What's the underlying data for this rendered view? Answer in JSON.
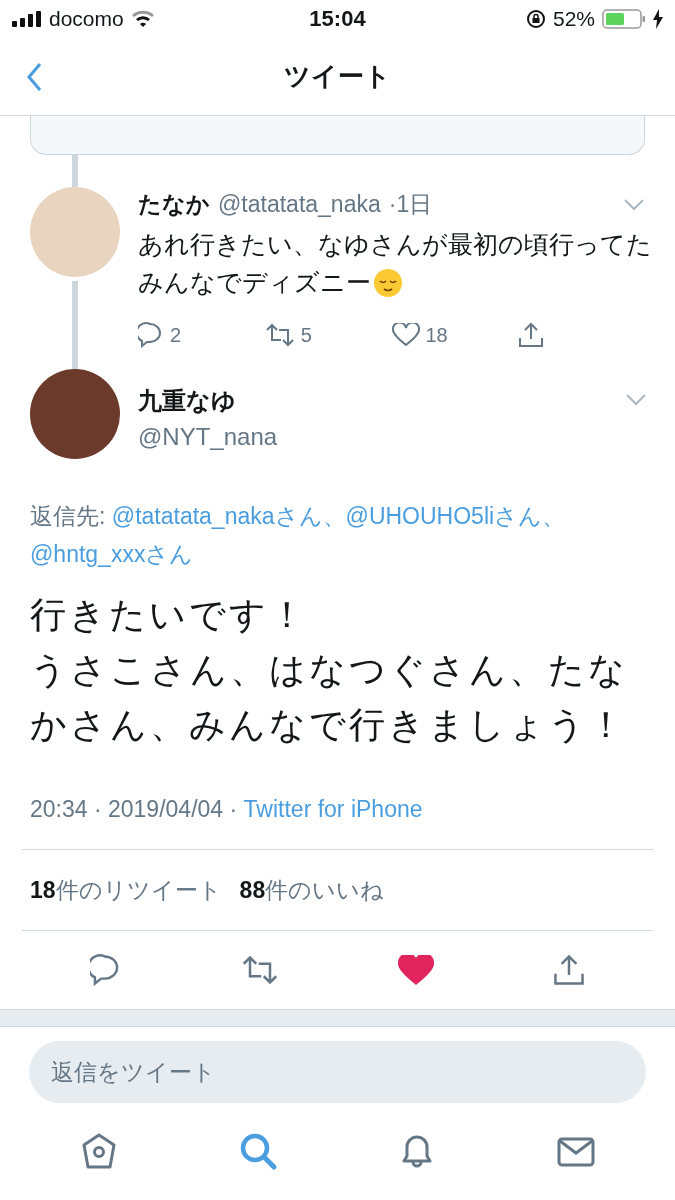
{
  "status_bar": {
    "carrier": "docomo",
    "time": "15:04",
    "battery": "52%"
  },
  "nav": {
    "title": "ツイート"
  },
  "reply_tweet": {
    "name": "たなか",
    "handle": "@tatatata_naka",
    "age": "·1日",
    "lines": [
      "あれ行きたい、なゆさんが最初の頃行ってた",
      "みんなでディズニー"
    ],
    "actions": [
      {
        "kind": "reply",
        "count": "2"
      },
      {
        "kind": "retweet",
        "count": "5"
      },
      {
        "kind": "like",
        "count": "18"
      },
      {
        "kind": "share"
      }
    ]
  },
  "tweet": {
    "name": "九重なゆ",
    "handle": "@NYT_nana",
    "reply_label": "返信先:",
    "reply_to": [
      "@tatatata_nakaさん、",
      "@UHOUHO5liさん、",
      "@hntg_xxxさん"
    ],
    "lines": [
      "行きたいです！",
      "うさこさん、はなつぐさん、たな",
      "かさん、みんなで行きましょう！"
    ],
    "time": "20:34 · 2019/04/04 ·",
    "source": "Twitter for iPhone",
    "stats": [
      {
        "count": "18",
        "label": "件のリツイート"
      },
      {
        "count": "88",
        "label": "件のいいね"
      }
    ],
    "actions": [
      {
        "kind": "reply"
      },
      {
        "kind": "retweet"
      },
      {
        "kind": "like",
        "liked": true
      },
      {
        "kind": "share"
      }
    ]
  },
  "reply_field": {
    "placeholder": "返信をツイート"
  },
  "tabs": [
    {
      "kind": "home",
      "selected": false
    },
    {
      "kind": "search",
      "selected": true
    },
    {
      "kind": "notifications",
      "selected": false
    },
    {
      "kind": "messages",
      "selected": false
    }
  ]
}
